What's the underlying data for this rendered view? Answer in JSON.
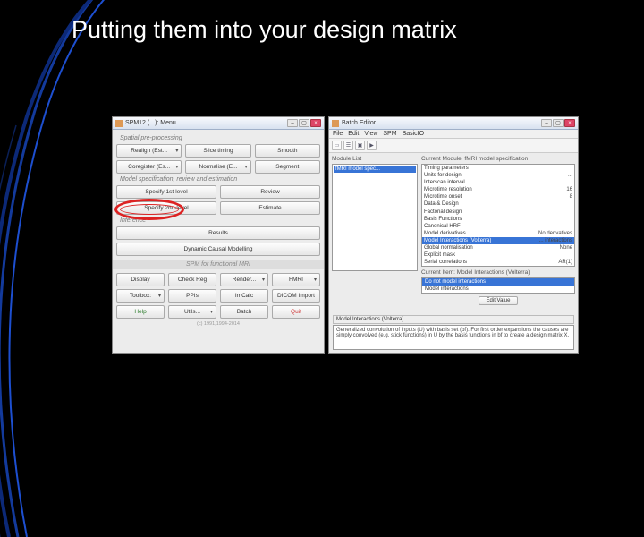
{
  "slide": {
    "title": "Putting them into your design matrix"
  },
  "spm": {
    "title": "SPM12 (...): Menu",
    "sections": {
      "spatial": "Spatial pre-processing",
      "model": "Model specification, review and estimation",
      "inference": "Inference",
      "footer_bar": "SPM for functional MRI",
      "copyright": "(c) 1991,1994-2014"
    },
    "buttons": {
      "realign": "Realign (Est...",
      "slice": "Slice timing",
      "smooth": "Smooth",
      "coreg": "Coregister (Es...",
      "normalise": "Normalise (E...",
      "segment": "Segment",
      "spec1": "Specify 1st-level",
      "review": "Review",
      "spec2": "Specify 2nd-level",
      "estimate": "Estimate",
      "results": "Results",
      "dcm": "Dynamic Causal Modelling",
      "display": "Display",
      "checkreg": "Check Reg",
      "render": "Render...",
      "fmri": "FMRI",
      "toolbox": "Toolbox:",
      "ppis": "PPIs",
      "imcalc": "ImCalc",
      "dicom": "DICOM Import",
      "help": "Help",
      "utils": "Utils...",
      "batch": "Batch",
      "quit": "Quit"
    }
  },
  "batch": {
    "title": "Batch Editor",
    "menu": {
      "file": "File",
      "edit": "Edit",
      "view": "View",
      "spm": "SPM",
      "basicio": "BasicIO"
    },
    "toolbar_icons": [
      "new-icon",
      "open-icon",
      "save-icon",
      "run-icon"
    ],
    "module_list_label": "Module List",
    "module_item": "fMRI model spec...",
    "tree_label": "Current Module: fMRI model specification",
    "tree": [
      {
        "k": "Timing parameters",
        "v": ""
      },
      {
        "k": "  Units for design",
        "v": "..."
      },
      {
        "k": "  Interscan interval",
        "v": "..."
      },
      {
        "k": "  Microtime resolution",
        "v": "16"
      },
      {
        "k": "  Microtime onset",
        "v": "8"
      },
      {
        "k": "Data & Design",
        "v": ""
      },
      {
        "k": "Factorial design",
        "v": ""
      },
      {
        "k": "Basis Functions",
        "v": ""
      },
      {
        "k": "  Canonical HRF",
        "v": ""
      },
      {
        "k": "    Model derivatives",
        "v": "No derivatives"
      },
      {
        "k": "Model Interactions (Volterra)",
        "v": "... interactions",
        "hi": true
      },
      {
        "k": "Global normalisation",
        "v": "None"
      },
      {
        "k": "Explicit mask",
        "v": ""
      },
      {
        "k": "Serial correlations",
        "v": "AR(1)"
      }
    ],
    "sub_label": "Current Item: Model Interactions (Volterra)",
    "sub_items": [
      {
        "t": "Do not model interactions",
        "hi": true
      },
      {
        "t": "Model interactions",
        "hi": false
      }
    ],
    "edit_value": "Edit Value",
    "info_label": "Model Interactions (Volterra)",
    "info_text": "Generalized convolution of inputs (U) with basis set (bf).\nFor first order expansions the causes are simply convolved (e.g. stick functions) in U by the basis functions in bf to create a design matrix X."
  }
}
